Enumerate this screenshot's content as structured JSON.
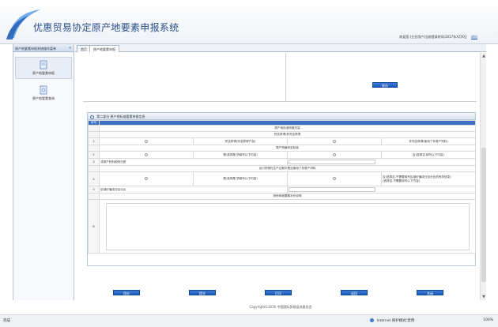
{
  "header": {
    "title": "优惠贸易协定原产地要素申报系统",
    "user_info": "欢迎您:(企业用户)当前登录时间:2017年X月X日",
    "logout_label": "退出"
  },
  "sidebar": {
    "title": "原产地要素申报系统操作菜单",
    "collapse": "«",
    "items": [
      {
        "label": "原产地要素申报"
      },
      {
        "label": "原产地要素查询"
      }
    ]
  },
  "tabs": [
    {
      "label": "首页"
    },
    {
      "label": "原产地要素申报"
    }
  ],
  "upper_pane": {
    "button_label": "保存"
  },
  "form": {
    "title": "第二部分 原产地标准要素申报信息",
    "header_cols": [
      "序号",
      ""
    ],
    "rows": [
      {
        "num": "",
        "text": "原产地标准申报内容"
      },
      {
        "num": "",
        "text": "完全获得/非完全获得"
      },
      {
        "num": "1",
        "left": "完全获得(完全获得产品)",
        "right": "非完全获得(使用了非原产材料)"
      },
      {
        "num": "",
        "text": "原产资格判定标准"
      },
      {
        "num": "2",
        "left": "是(选择是,须填写以下内容)",
        "right": "否(选择否,填写以下内容)"
      },
      {
        "num": "3",
        "text": "非原产材料税则归类"
      },
      {
        "num": "",
        "text": "出口货物在生产过程中是否使用了非原产材料"
      },
      {
        "num": "4",
        "left": "是(选择是,须填写以下内容)",
        "right": "否(选择否,不需要填写区域价值成分百分比的有关信息)",
        "right2": "(选择否,不需要填写以下内容)"
      },
      {
        "num": "5",
        "text": "区域价值成分百分比"
      },
      {
        "num": "",
        "text": "其他申报要素补充说明"
      },
      {
        "num": "6",
        "text": ""
      }
    ]
  },
  "buttons": [
    {
      "label": "保存"
    },
    {
      "label": "提交"
    },
    {
      "label": "打印"
    },
    {
      "label": "返回"
    },
    {
      "label": "关闭"
    }
  ],
  "footer": {
    "copyright": "Copyright©2016 中国国际贸易促进委员会"
  },
  "statusbar": {
    "status": "完成",
    "zone": "Internet 保护模式:禁用",
    "zoom": "100%"
  },
  "colors": {
    "accent": "#1b5bb8",
    "table_header": "#3c6fc4"
  }
}
